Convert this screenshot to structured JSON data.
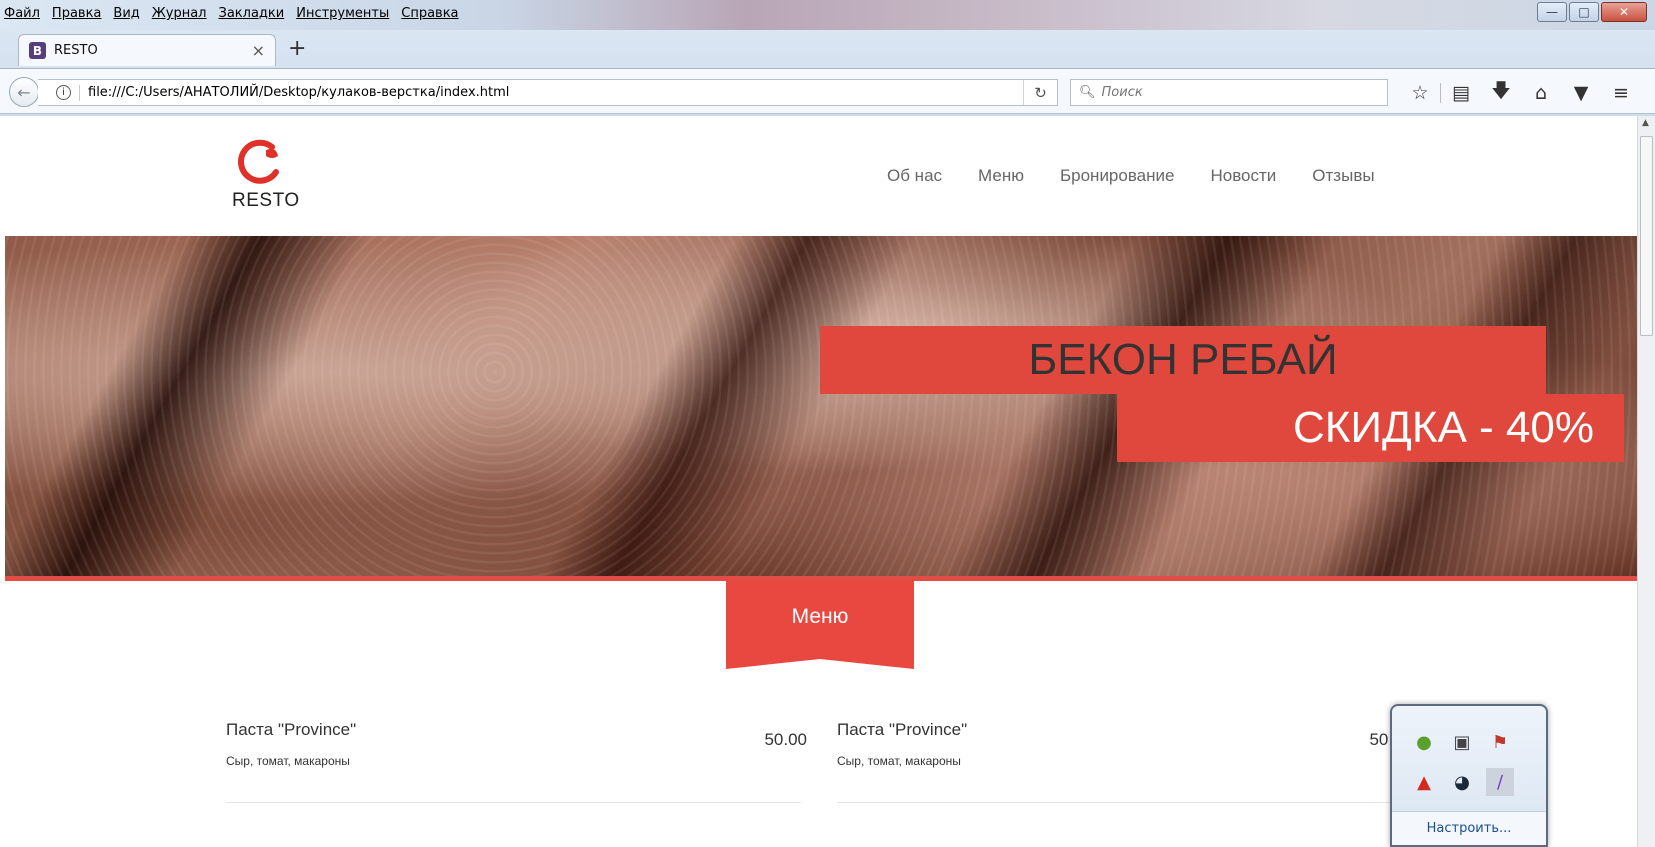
{
  "browser": {
    "menu": [
      "Файл",
      "Правка",
      "Вид",
      "Журнал",
      "Закладки",
      "Инструменты",
      "Справка"
    ],
    "tab_title": "RESTO",
    "tab_favicon": "B",
    "url": "file:///C:/Users/АНАТОЛИЙ/Desktop/кулаков-верстка/index.html",
    "search_placeholder": "Поиск",
    "toolbar_icons": [
      "bookmark-star-icon",
      "reading-list-icon",
      "download-icon",
      "home-icon",
      "pocket-icon",
      "hamburger-menu-icon"
    ]
  },
  "site": {
    "logo_text": "RESTO",
    "brand_color": "#e0483e",
    "nav": [
      "Об нас",
      "Меню",
      "Бронирование",
      "Новости",
      "Отзывы"
    ],
    "hero": {
      "title": "БЕКОН РЕБАЙ",
      "sale": "СКИДКА - 40%"
    },
    "menu_section_label": "Меню",
    "menu_items": [
      {
        "name": "Паста \"Province\"",
        "desc": "Сыр, томат, макароны",
        "price": "50.00"
      },
      {
        "name": "Паста \"Province\"",
        "desc": "Сыр, томат, макароны",
        "price": "50.00"
      }
    ]
  },
  "tray": {
    "link": "Настроить...",
    "icons": [
      "evernote-icon",
      "usb-device-icon",
      "action-center-flag-icon",
      "warning-icon",
      "steam-icon",
      "pen-tablet-icon"
    ]
  }
}
